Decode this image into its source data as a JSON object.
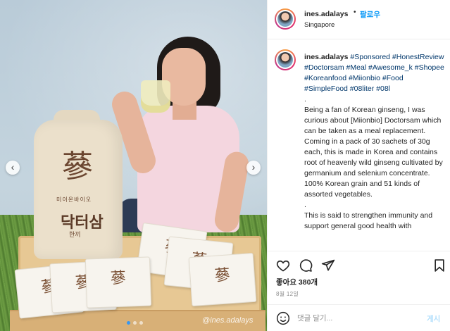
{
  "post": {
    "username": "ines.adalays",
    "follow_label": "팔로우",
    "location": "Singapore",
    "watermark": "@ines.adalays"
  },
  "photo": {
    "bag_brand": "미이온바이오",
    "bag_name": "닥터삼",
    "bag_sub": "한끼",
    "carousel_total": 3,
    "carousel_current": 1
  },
  "caption": {
    "username": "ines.adalays",
    "hashtags": "#Sponsored #HonestReview #Doctorsam #Meal #Awesome_k #Shopee #Koreanfood #Miionbio #Food #SimpleFood #08liter #08l",
    "sep1": ".",
    "para1": "Being a fan of Korean ginseng, I was curious about [Miionbio] Doctorsam which can be taken as a meal replacement. Coming in a pack of 30 sachets of 30g each, this is made in Korea and contains root of heavenly wild ginseng cultivated by germanium and selenium concentrate. 100% Korean grain and 51 kinds of assorted vegetables.",
    "sep2": ".",
    "para2": "This is said to strengthen immunity and support general good health with"
  },
  "actions": {
    "likes": "좋아요 380개",
    "date": "8월 12일"
  },
  "comment": {
    "placeholder": "댓글 달기...",
    "post_label": "게시"
  },
  "colors": {
    "link": "#0095f6",
    "hashtag": "#00376b",
    "muted": "#8e8e8e",
    "carousel_active": "#3897f0"
  },
  "icons": [
    "heart-icon",
    "comment-icon",
    "share-icon",
    "bookmark-icon",
    "emoji-icon",
    "chevron-left-icon",
    "chevron-right-icon"
  ]
}
